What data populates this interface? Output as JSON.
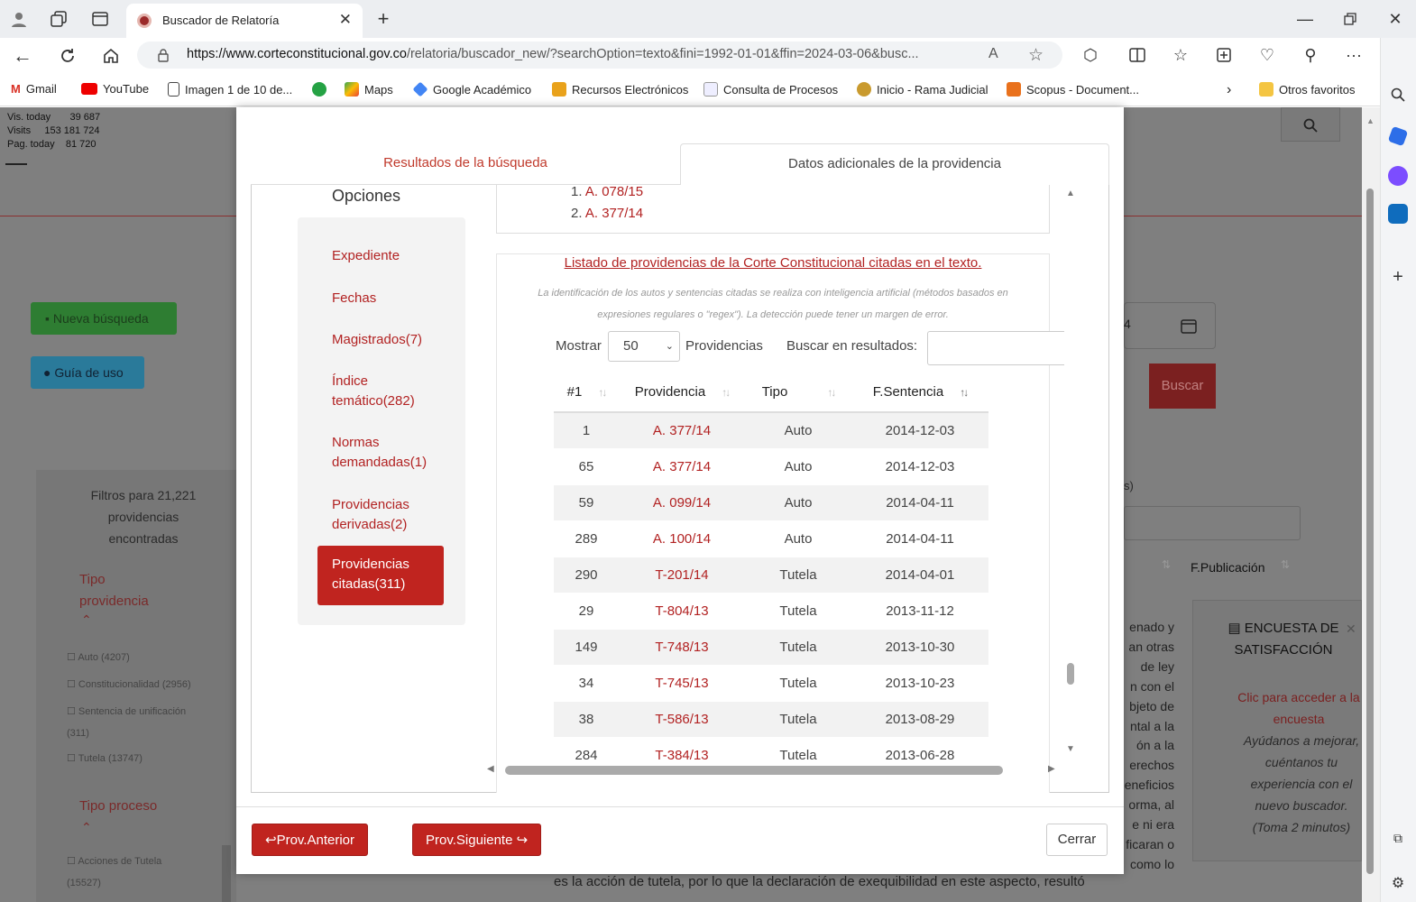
{
  "browser": {
    "tab_title": "Buscador de Relatoría",
    "url_domain": "https://www.corteconstitucional.gov.co",
    "url_path": "/relatoria/buscador_new/?searchOption=texto&fini=1992-01-01&ffin=2024-03-06&busc...",
    "read_aloud": "A",
    "bookmarks": [
      "Gmail",
      "YouTube",
      "Imagen 1 de 10 de...",
      "Maps",
      "Google Académico",
      "Recursos Electrónicos",
      "Consulta de Procesos",
      "Inicio - Rama Judicial",
      "Scopus - Document..."
    ],
    "other_favorites": "Otros favoritos",
    "more": "···"
  },
  "background": {
    "stats": {
      "vis_today_label": "Vis. today",
      "vis_today": "39 687",
      "visits_label": "Visits",
      "visits": "153 181 724",
      "pag_today_label": "Pag. today",
      "pag_today": "81 720"
    },
    "nueva_busqueda": "Nueva búsqueda",
    "guia_de_uso": "Guía de uso",
    "filtros": "Filtros para 21,221 providencias encontradas",
    "tipo_providencia": "Tipo providencia",
    "checks": [
      "Auto (4207)",
      "Constitucionalidad (2956)",
      "Sentencia de unificación (311)",
      "Tutela (13747)"
    ],
    "tipo_proceso": "Tipo proceso",
    "check_proceso": "Acciones de Tutela (15527)",
    "buscar": "Buscar",
    "fpub": "F.Publicación",
    "s_suffix": "s)",
    "date_digit": "4",
    "encuesta_title": "ENCUESTA DE SATISFACCIÓN",
    "encuesta_link": "Clic para acceder a la encuesta",
    "encuesta_body": "Ayúdanos a mejorar, cuéntanos tu experiencia con el nuevo buscador. (Toma 2 minutos)",
    "text_lines": [
      "enado y",
      "an otras",
      "de ley",
      "n con el",
      "bjeto de",
      "ntal a la",
      "ón a la",
      "erechos",
      "eneficios",
      "orma, al",
      "e ni era",
      "ficaran o",
      "como lo"
    ],
    "bottom_line": "es la acción de tutela, por lo que la declaración de exequibilidad en este aspecto, resultó"
  },
  "modal": {
    "tab_results": "Resultados de la búsqueda",
    "tab_extra": "Datos adicionales de la providencia",
    "opciones": "Opciones",
    "options": [
      "Expediente",
      "Fechas",
      "Magistrados(7)",
      "Índice temático(282)",
      "Normas demandadas(1)",
      "Providencias derivadas(2)"
    ],
    "selected_option": "Providencias citadas(311)",
    "prev_list": [
      {
        "n": "1.",
        "label": "A. 078/15"
      },
      {
        "n": "2.",
        "label": "A. 377/14"
      }
    ],
    "listado_title": "Listado de providencias de la Corte Constitucional citadas en el texto.",
    "listado_note": "La identificación de los autos y sentencias citadas se realiza con inteligencia artificial (métodos basados en expresiones regulares o \"regex\"). La detección puede tener un margen de error.",
    "mostrar": "Mostrar",
    "mostrar_value": "50",
    "providencias": "Providencias",
    "buscar_en": "Buscar en resultados:",
    "columns": [
      "#1",
      "Providencia",
      "Tipo",
      "F.Sentencia"
    ],
    "rows": [
      {
        "n": "1",
        "p": "A. 377/14",
        "t": "Auto",
        "f": "2014-12-03"
      },
      {
        "n": "65",
        "p": "A. 377/14",
        "t": "Auto",
        "f": "2014-12-03"
      },
      {
        "n": "59",
        "p": "A. 099/14",
        "t": "Auto",
        "f": "2014-04-11"
      },
      {
        "n": "289",
        "p": "A. 100/14",
        "t": "Auto",
        "f": "2014-04-11"
      },
      {
        "n": "290",
        "p": "T-201/14",
        "t": "Tutela",
        "f": "2014-04-01"
      },
      {
        "n": "29",
        "p": "T-804/13",
        "t": "Tutela",
        "f": "2013-11-12"
      },
      {
        "n": "149",
        "p": "T-748/13",
        "t": "Tutela",
        "f": "2013-10-30"
      },
      {
        "n": "34",
        "p": "T-745/13",
        "t": "Tutela",
        "f": "2013-10-23"
      },
      {
        "n": "38",
        "p": "T-586/13",
        "t": "Tutela",
        "f": "2013-08-29"
      },
      {
        "n": "284",
        "p": "T-384/13",
        "t": "Tutela",
        "f": "2013-06-28"
      }
    ],
    "prev_button": "Prov.Anterior",
    "next_button": "Prov.Siguiente",
    "close_button": "Cerrar"
  }
}
